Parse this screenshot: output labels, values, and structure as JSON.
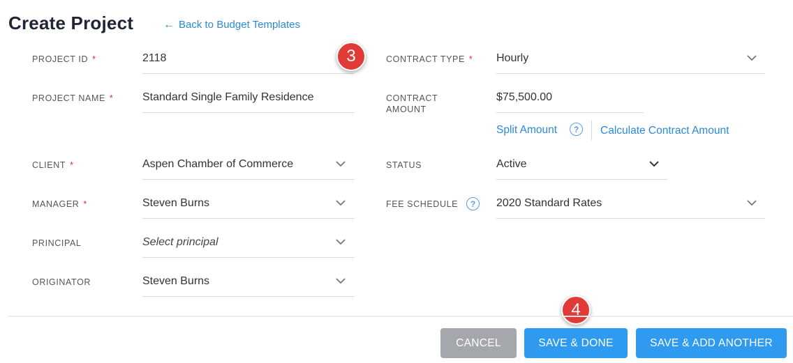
{
  "header": {
    "title": "Create Project",
    "back_arrow": "←",
    "back_link": "Back to Budget Templates"
  },
  "form": {
    "required_mark": "*",
    "project_id": {
      "label": "PROJECT ID",
      "value": "2118"
    },
    "project_name": {
      "label": "PROJECT NAME",
      "value": "Standard Single Family Residence"
    },
    "client": {
      "label": "CLIENT",
      "value": "Aspen Chamber of Commerce"
    },
    "manager": {
      "label": "MANAGER",
      "value": "Steven Burns"
    },
    "principal": {
      "label": "PRINCIPAL",
      "placeholder": "Select principal"
    },
    "originator": {
      "label": "ORIGINATOR",
      "value": "Steven Burns"
    },
    "contract_type": {
      "label": "CONTRACT TYPE",
      "value": "Hourly"
    },
    "contract_amount": {
      "label_line1": "CONTRACT",
      "label_line2": "AMOUNT",
      "value": "$75,500.00",
      "split_link": "Split Amount",
      "help": "?",
      "calculate_link": "Calculate Contract Amount"
    },
    "status": {
      "label": "STATUS",
      "value": "Active"
    },
    "fee_schedule": {
      "label": "FEE SCHEDULE",
      "help": "?",
      "value": "2020 Standard Rates"
    }
  },
  "annotations": {
    "step3": "3",
    "step4": "4"
  },
  "footer": {
    "cancel": "CANCEL",
    "save_done": "SAVE & DONE",
    "save_add": "SAVE & ADD ANOTHER"
  },
  "colors": {
    "accent": "#2b88d8",
    "primary_button": "#2f9bf0",
    "cancel_button": "#a4a8ad",
    "required": "#e0312f",
    "badge": "#e03b37"
  },
  "icons": {
    "dropdown": "chevron-down-icon",
    "help": "question-circle-icon",
    "back": "arrow-left-icon"
  }
}
